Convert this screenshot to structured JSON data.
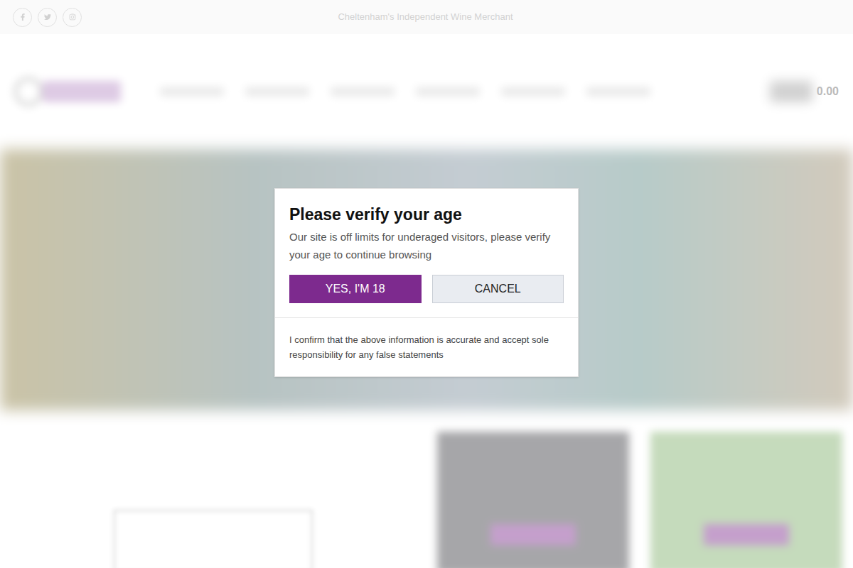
{
  "topbar": {
    "social": [
      {
        "network": "facebook"
      },
      {
        "network": "twitter"
      },
      {
        "network": "instagram"
      }
    ],
    "tagline": "Cheltenham's Independent Wine Merchant"
  },
  "header": {
    "cart_total": "0.00"
  },
  "modal": {
    "title": "Please verify your age",
    "message": "Our site is off limits for underaged visitors, please verify your age to continue browsing",
    "buttons": [
      {
        "label": "YES, I'M 18",
        "kind": "primary"
      },
      {
        "label": "CANCEL",
        "kind": "secondary"
      }
    ],
    "disclaimer": "I confirm that the above information is accurate and accept sole responsibility for any false statements"
  }
}
